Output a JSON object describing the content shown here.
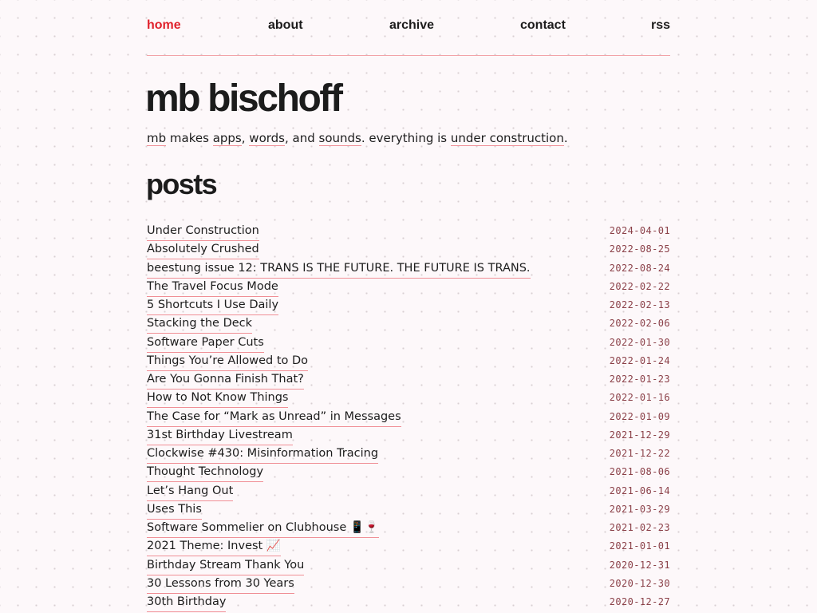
{
  "nav": {
    "home": "home",
    "about": "about",
    "archive": "archive",
    "contact": "contact",
    "rss": "rss"
  },
  "site": {
    "title": "mb bischoff",
    "tagline": {
      "mb": "mb",
      "t1": " makes ",
      "apps": "apps",
      "t2": ", ",
      "words": "words",
      "t3": ", and ",
      "sounds": "sounds",
      "t4": ". everything is ",
      "under_construction": "under construction",
      "t5": "."
    }
  },
  "posts_heading": "posts",
  "posts": [
    {
      "title": "Under Construction",
      "date": "2024-04-01"
    },
    {
      "title": "Absolutely Crushed",
      "date": "2022-08-25"
    },
    {
      "title": "beestung issue 12: TRANS IS THE FUTURE. THE FUTURE IS TRANS.",
      "date": "2022-08-24"
    },
    {
      "title": "The Travel Focus Mode",
      "date": "2022-02-22"
    },
    {
      "title": "5 Shortcuts I Use Daily",
      "date": "2022-02-13"
    },
    {
      "title": "Stacking the Deck",
      "date": "2022-02-06"
    },
    {
      "title": "Software Paper Cuts",
      "date": "2022-01-30"
    },
    {
      "title": "Things You’re Allowed to Do",
      "date": "2022-01-24"
    },
    {
      "title": "Are You Gonna Finish That?",
      "date": "2022-01-23"
    },
    {
      "title": "How to Not Know Things",
      "date": "2022-01-16"
    },
    {
      "title": "The Case for “Mark as Unread” in Messages",
      "date": "2022-01-09"
    },
    {
      "title": "31st Birthday Livestream",
      "date": "2021-12-29"
    },
    {
      "title": "Clockwise #430: Misinformation Tracing",
      "date": "2021-12-22"
    },
    {
      "title": "Thought Technology",
      "date": "2021-08-06"
    },
    {
      "title": "Let’s Hang Out",
      "date": "2021-06-14"
    },
    {
      "title": "Uses This",
      "date": "2021-03-29"
    },
    {
      "title": "Software Sommelier on Clubhouse 📱🍷",
      "date": "2021-02-23"
    },
    {
      "title": "2021 Theme: Invest 📈",
      "date": "2021-01-01"
    },
    {
      "title": "Birthday Stream Thank You",
      "date": "2020-12-31"
    },
    {
      "title": "30 Lessons from 30 Years",
      "date": "2020-12-30"
    },
    {
      "title": "30th Birthday",
      "date": "2020-12-27"
    }
  ]
}
